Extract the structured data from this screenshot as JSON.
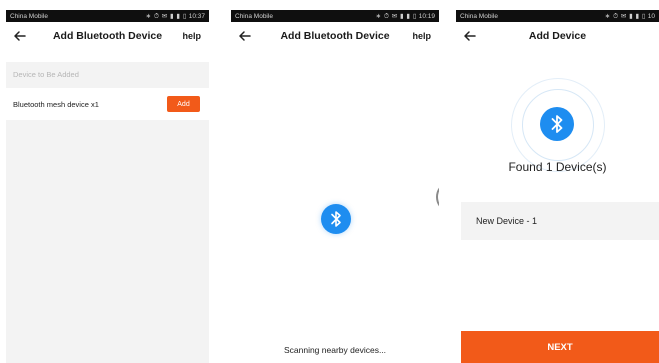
{
  "screens": [
    {
      "status_bar": {
        "carrier": "China Mobile",
        "icons": "∗ ⏱ ✉ ▮ ▮ ▯",
        "time": "10:37"
      },
      "nav": {
        "title": "Add Bluetooth Device",
        "help": "help"
      },
      "section_header": "Device to Be Added",
      "device": {
        "name": "Bluetooth mesh device x1",
        "action": "Add"
      }
    },
    {
      "status_bar": {
        "carrier": "China Mobile",
        "icons": "∗ ⏱ ✉ ▮ ▮ ▯",
        "time": "10:19"
      },
      "nav": {
        "title": "Add Bluetooth Device",
        "help": "help"
      },
      "scanning_text": "Scanning nearby devices..."
    },
    {
      "status_bar": {
        "carrier": "China Mobile",
        "icons": "∗ ⏱ ✉ ▮ ▮ ▯",
        "time": "10"
      },
      "nav": {
        "title": "Add Device"
      },
      "found_text": "Found 1 Device(s)",
      "device_name": "New Device - 1",
      "next_label": "NEXT"
    }
  ],
  "colors": {
    "accent": "#f25a19",
    "bluetooth": "#1e8df0"
  },
  "icons": {
    "back": "arrow-left-icon",
    "bluetooth": "bluetooth-icon"
  }
}
